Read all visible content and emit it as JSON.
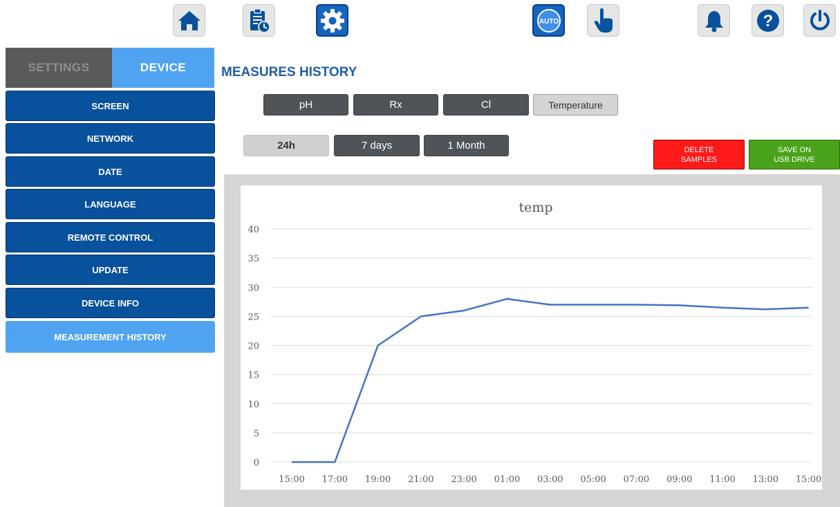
{
  "toolbar": {
    "items": [
      {
        "name": "home-icon",
        "active": false
      },
      {
        "name": "clipboard-clock-icon",
        "active": false
      },
      {
        "name": "gear-icon",
        "active": true
      },
      {
        "name": "auto-mode-icon",
        "active": true,
        "label": "AUTO"
      },
      {
        "name": "hand-pointer-icon",
        "active": false
      },
      {
        "name": "bell-icon",
        "active": false
      },
      {
        "name": "help-icon",
        "active": false
      },
      {
        "name": "power-icon",
        "active": false
      }
    ]
  },
  "sidebar": {
    "tabs": {
      "settings": "SETTINGS",
      "device": "DEVICE"
    },
    "items": [
      {
        "label": "SCREEN"
      },
      {
        "label": "NETWORK"
      },
      {
        "label": "DATE"
      },
      {
        "label": "LANGUAGE"
      },
      {
        "label": "REMOTE CONTROL"
      },
      {
        "label": "UPDATE"
      },
      {
        "label": "DEVICE INFO"
      },
      {
        "label": "MEASUREMENT HISTORY",
        "active": true
      }
    ]
  },
  "main": {
    "title": "MEASURES HISTORY",
    "measure_tabs": [
      {
        "label": "pH"
      },
      {
        "label": "Rx"
      },
      {
        "label": "Cl"
      },
      {
        "label": "Temperature",
        "selected": true
      }
    ],
    "range_tabs": [
      {
        "label": "24h",
        "selected": true
      },
      {
        "label": "7 days"
      },
      {
        "label": "1 Month"
      }
    ],
    "delete_button": {
      "line1": "DELETE",
      "line2": "SAMPLES"
    },
    "save_button": {
      "line1": "SAVE ON",
      "line2": "USB DRIVE"
    }
  },
  "colors": {
    "primary_blue": "#08519c",
    "active_blue": "#4fa3f0",
    "title_blue": "#1f5ea8",
    "line": "#4472c4",
    "delete_red": "#ff1a1a",
    "save_green": "#4aa31a"
  },
  "chart_data": {
    "type": "line",
    "title": "temp",
    "x": [
      "15:00",
      "17:00",
      "19:00",
      "21:00",
      "23:00",
      "01:00",
      "03:00",
      "05:00",
      "07:00",
      "09:00",
      "11:00",
      "13:00",
      "15:00"
    ],
    "series": [
      {
        "values": [
          0,
          0,
          20,
          25,
          26,
          28,
          27,
          27,
          27,
          26.9,
          26.5,
          26.2,
          26.5
        ]
      }
    ],
    "ylim": [
      0,
      40
    ],
    "yticks": [
      0,
      5,
      10,
      15,
      20,
      25,
      30,
      35,
      40
    ],
    "grid": true,
    "xlabel": "",
    "ylabel": ""
  }
}
